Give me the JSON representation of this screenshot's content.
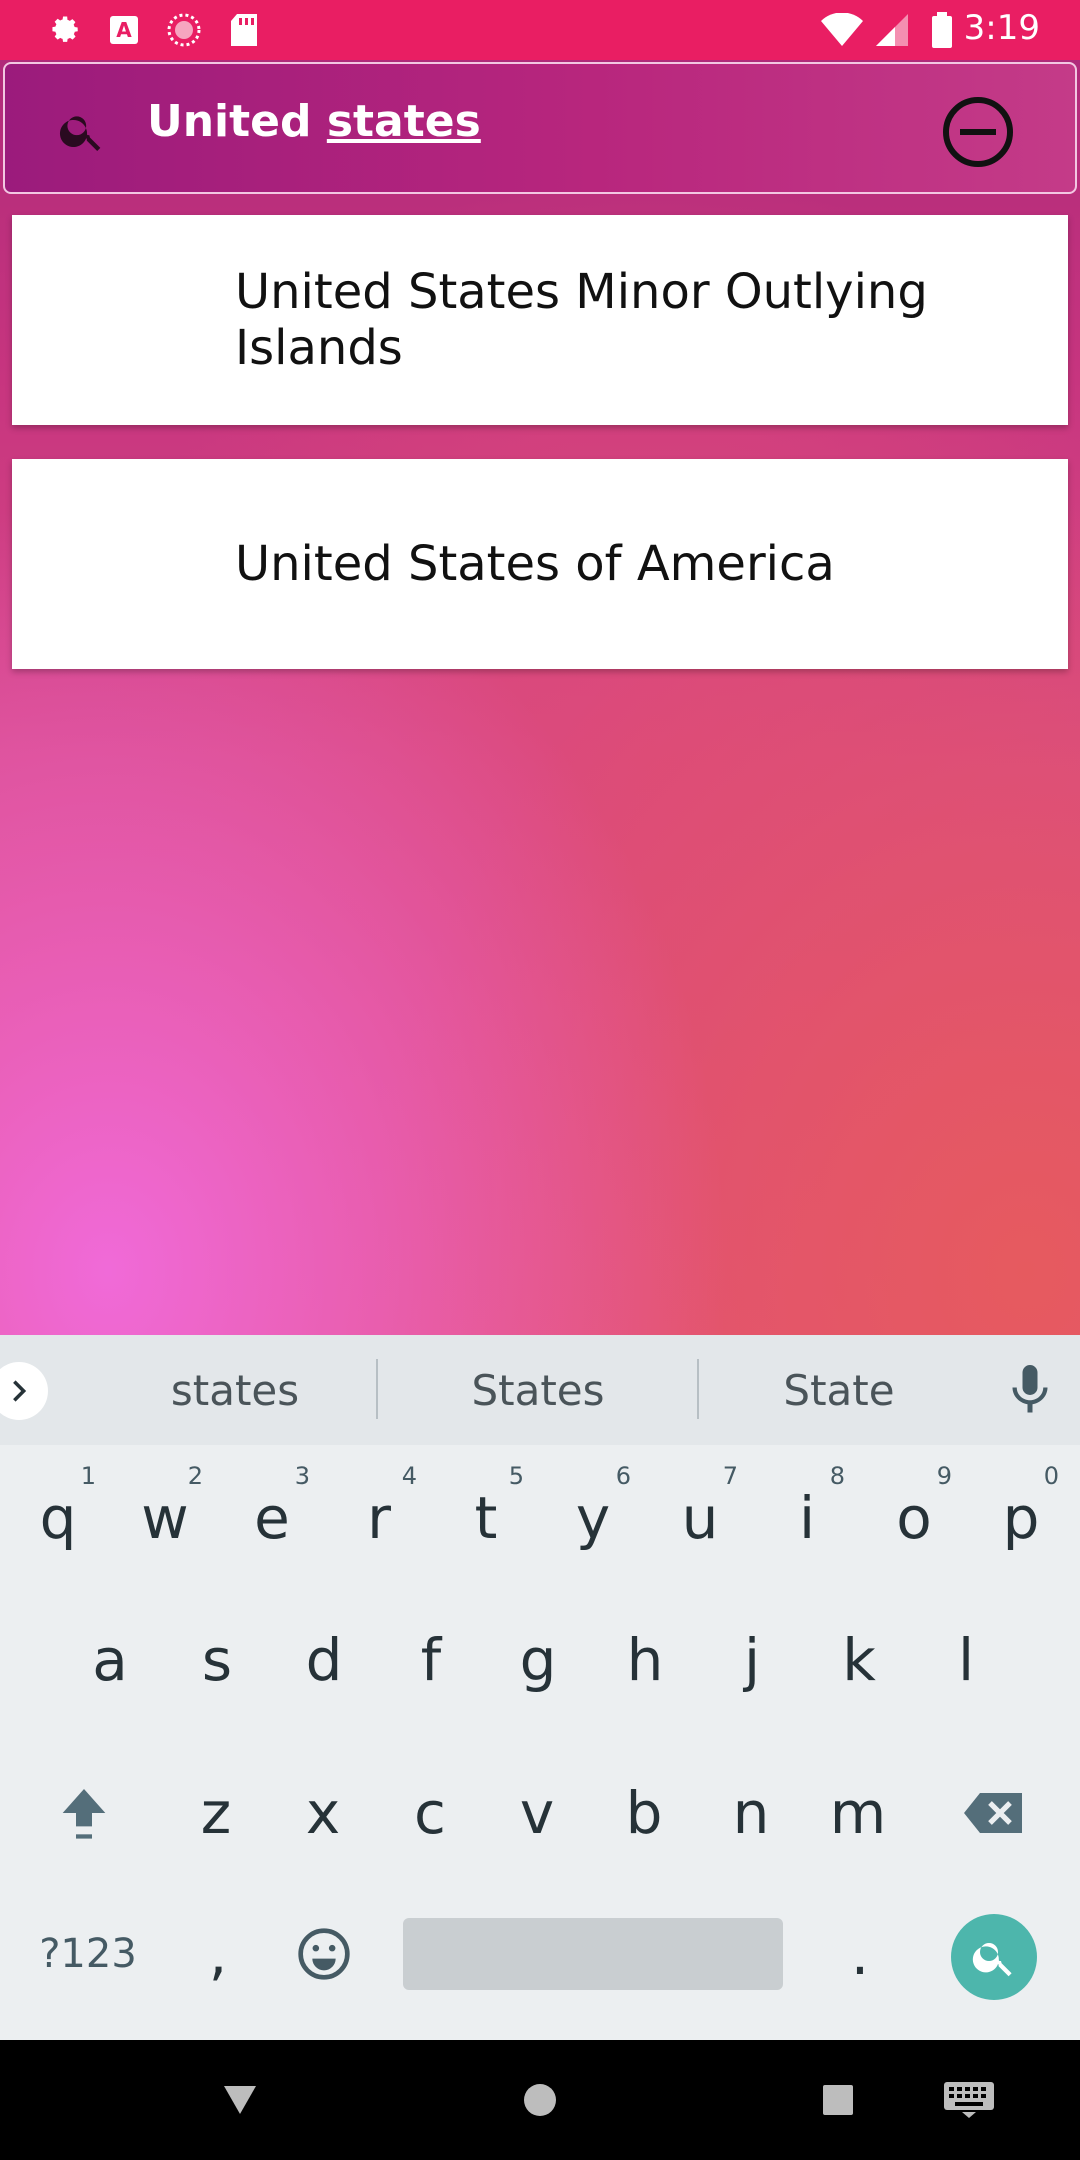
{
  "status_bar": {
    "time": "3:19",
    "icons": [
      "gear-icon",
      "a-icon",
      "circle-dots-icon",
      "sd-card-icon",
      "wifi-icon",
      "signal-icon",
      "battery-icon"
    ]
  },
  "search": {
    "query_prefix": "United ",
    "query_underlined": "states",
    "icon": "search-icon",
    "clear_icon": "minus-circle-icon"
  },
  "results": [
    {
      "label": "United States Minor Outlying Islands"
    },
    {
      "label": "United States of America"
    }
  ],
  "keyboard": {
    "suggestions": [
      "states",
      "States",
      "State"
    ],
    "rows": [
      [
        {
          "k": "q",
          "h": "1"
        },
        {
          "k": "w",
          "h": "2"
        },
        {
          "k": "e",
          "h": "3"
        },
        {
          "k": "r",
          "h": "4"
        },
        {
          "k": "t",
          "h": "5"
        },
        {
          "k": "y",
          "h": "6"
        },
        {
          "k": "u",
          "h": "7"
        },
        {
          "k": "i",
          "h": "8"
        },
        {
          "k": "o",
          "h": "9"
        },
        {
          "k": "p",
          "h": "0"
        }
      ],
      [
        {
          "k": "a"
        },
        {
          "k": "s"
        },
        {
          "k": "d"
        },
        {
          "k": "f"
        },
        {
          "k": "g"
        },
        {
          "k": "h"
        },
        {
          "k": "j"
        },
        {
          "k": "k"
        },
        {
          "k": "l"
        }
      ],
      [
        {
          "k": "z"
        },
        {
          "k": "x"
        },
        {
          "k": "c"
        },
        {
          "k": "v"
        },
        {
          "k": "b"
        },
        {
          "k": "n"
        },
        {
          "k": "m"
        }
      ]
    ],
    "symbols_label": "?123",
    "comma": ",",
    "period": ".",
    "emoji_icon": "emoji-icon",
    "shift_icon": "shift-icon",
    "backspace_icon": "backspace-icon",
    "enter_icon": "search-icon",
    "mic_icon": "mic-icon"
  },
  "colors": {
    "status_bar": "#e91e63",
    "accent": "#4db6ac",
    "keyboard_bg": "#eceff1"
  }
}
